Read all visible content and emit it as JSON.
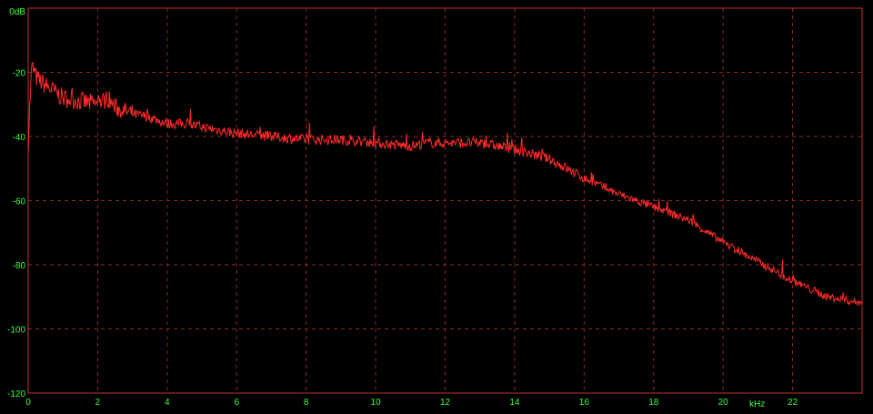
{
  "chart_data": {
    "type": "line",
    "title": "",
    "xlabel": "kHz",
    "ylabel": "",
    "xlim": [
      0,
      24
    ],
    "ylim": [
      -120,
      0
    ],
    "grid": true,
    "legend": "none",
    "x_ticks": [
      0,
      2,
      4,
      6,
      8,
      10,
      12,
      14,
      16,
      18,
      20,
      22
    ],
    "y_ticks": [
      0,
      -20,
      -40,
      -60,
      -80,
      -100,
      -120
    ],
    "y_tick_labels": [
      "0dB",
      "-20",
      "-40",
      "-60",
      "-80",
      "-100",
      "-120"
    ],
    "x_unit_label": "kHz",
    "colors": {
      "background": "#000000",
      "frame": "#c83232",
      "grid": "#8c2828",
      "labels": "#39ff39",
      "series": "#ff2a2a"
    },
    "series": [
      {
        "color": "#ff2a2a",
        "x": [
          0,
          0.1,
          0.25,
          0.5,
          0.75,
          1.0,
          1.5,
          2.0,
          2.3,
          2.5,
          3.0,
          3.5,
          4.0,
          4.5,
          5.0,
          6.0,
          7.0,
          8.0,
          9.0,
          10.0,
          11.0,
          11.5,
          12.0,
          13.0,
          14.0,
          15.0,
          15.5,
          16.0,
          17.0,
          18.0,
          19.0,
          20.0,
          21.0,
          22.0,
          23.0,
          24.0
        ],
        "y": [
          -42,
          -18,
          -22,
          -24,
          -26,
          -28,
          -29,
          -30,
          -28,
          -31,
          -33,
          -34,
          -36,
          -36,
          -37,
          -39,
          -40,
          -41,
          -41,
          -42,
          -43,
          -42,
          -42,
          -42,
          -44,
          -47,
          -50,
          -53,
          -58,
          -62,
          -66,
          -73,
          -79,
          -85,
          -90,
          -92
        ]
      }
    ]
  }
}
